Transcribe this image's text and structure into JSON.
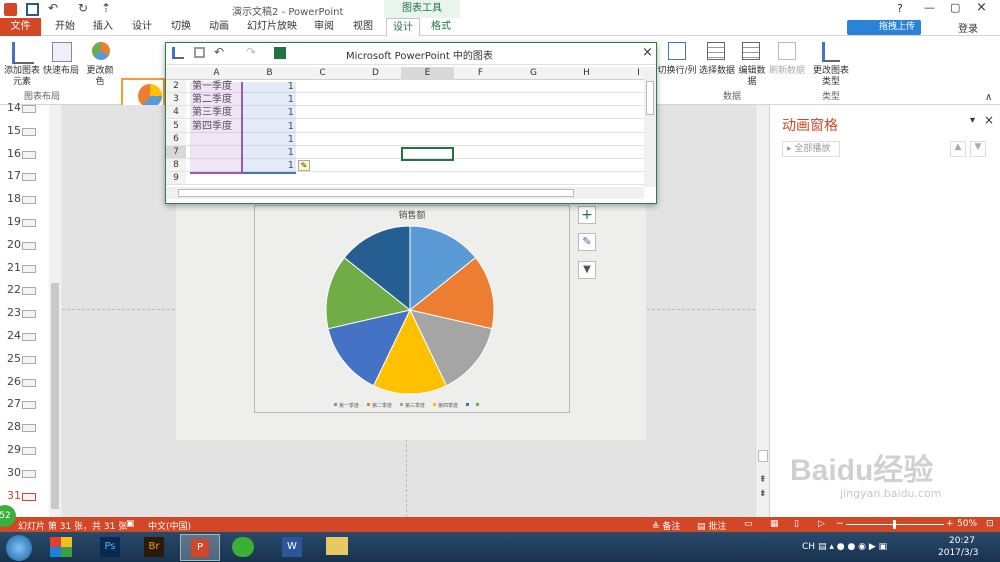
{
  "app": {
    "doc_title": "演示文稿2 - PowerPoint",
    "context_tab_group": "图表工具",
    "help": "?",
    "login": "登录",
    "upload_label": "拖拽上传"
  },
  "tabs": [
    "文件",
    "开始",
    "插入",
    "设计",
    "切换",
    "动画",
    "幻灯片放映",
    "审阅",
    "视图",
    "设计",
    "格式"
  ],
  "ribbon": {
    "add_element": "添加图表元素",
    "quick_layout": "快速布局",
    "change_colors": "更改颜色",
    "group_layout": "图表布局",
    "switch_rowcol": "切换行/列",
    "select_data": "选择数据",
    "edit_data": "编辑数据",
    "refresh_data": "刷新数据",
    "group_data": "数据",
    "change_type": "更改图表类型",
    "group_type": "类型"
  },
  "spreadsheet": {
    "title": "Microsoft PowerPoint 中的图表",
    "columns": [
      "A",
      "B",
      "C",
      "D",
      "E",
      "F",
      "G",
      "H",
      "I"
    ],
    "rows": [
      {
        "n": "2",
        "a": "第一季度",
        "b": "1"
      },
      {
        "n": "3",
        "a": "第二季度",
        "b": "1"
      },
      {
        "n": "4",
        "a": "第三季度",
        "b": "1"
      },
      {
        "n": "5",
        "a": "第四季度",
        "b": "1"
      },
      {
        "n": "6",
        "a": "",
        "b": "1"
      },
      {
        "n": "7",
        "a": "",
        "b": "1"
      },
      {
        "n": "8",
        "a": "",
        "b": "1"
      },
      {
        "n": "9",
        "a": "",
        "b": ""
      }
    ]
  },
  "slide_numbers": [
    "14",
    "15",
    "16",
    "17",
    "18",
    "19",
    "20",
    "21",
    "22",
    "23",
    "24",
    "25",
    "26",
    "27",
    "28",
    "29",
    "30",
    "31"
  ],
  "animation_pane": {
    "title": "动画窗格",
    "play_all": "全部播放"
  },
  "status": {
    "slide_info": "幻灯片 第 31 张，共 31 张",
    "language": "中文(中国)",
    "notes": "备注",
    "comments": "批注",
    "zoom": "50%",
    "badge": "52"
  },
  "taskbar": {
    "time": "20:27",
    "date": "2017/3/3",
    "lang": "CH"
  },
  "watermark": "Bai du 经验 jingyan.baidu.com",
  "chart_data": {
    "type": "pie",
    "title": "销售额",
    "categories": [
      "第一季度",
      "第二季度",
      "第三季度",
      "第四季度",
      "",
      ""
    ],
    "values": [
      1,
      1,
      1,
      1,
      1,
      1,
      1
    ],
    "legend": [
      "第一季度",
      "第二季度",
      "第三季度",
      "第四季度",
      "",
      ""
    ],
    "colors": [
      "#5b9bd5",
      "#ed7d31",
      "#a5a5a5",
      "#ffc000",
      "#4472c4",
      "#70ad47",
      "#255e91"
    ]
  }
}
